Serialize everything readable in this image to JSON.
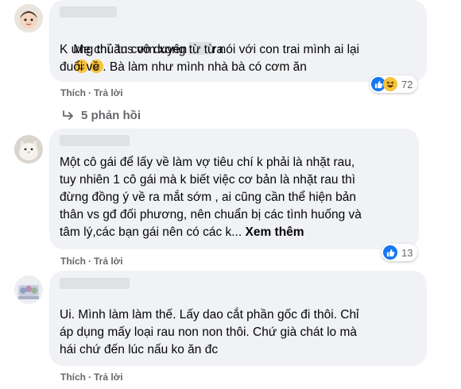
{
  "comments": [
    {
      "line1": "Mẹ chủ tus vô duyên",
      "line1_tail": "ra",
      "body": "K ưng thì ăn cơm xong từ từ nói với con trai mình ai lại\nđuổi về . Bà làm như mình nhà bà có cơm ăn",
      "like": "Thích",
      "reply": "Trả lời",
      "reaction_count": "72",
      "replies_label": "5 phản hồi"
    },
    {
      "body": "Một cô gái để lấy về làm vợ tiêu chí k phải là nhặt rau,\ntuy nhiên 1 cô gái mà k biết việc cơ bản là nhặt rau thì\nđừng đồng ý về ra mắt sớm , ai cũng cần thể hiện bản\nthân vs gđ đối phương, nên chuẩn bị các tình huống và\ntâm lý,các bạn gái nên có các k...",
      "see_more": "Xem thêm",
      "like": "Thích",
      "reply": "Trả lời",
      "reaction_count": "13"
    },
    {
      "body": "Ui. Mình làm làm thế. Lấy dao cắt phần gốc đi thôi. Chỉ\náp dụng mấy loại rau non non thôi. Chứ già chát lo mà\nhái chứ đến lúc nấu ko ăn đc",
      "like": "Thích",
      "reply": "Trả lời"
    }
  ],
  "colors": {
    "bubble": "#f0f2f5",
    "meta": "#65676b",
    "like_blue": "#1877f2",
    "haha_yellow": "#f7c33b"
  },
  "icons": [
    "reply-arrow-icon",
    "like-reaction-icon",
    "haha-reaction-icon",
    "smile-emoji-icon"
  ]
}
